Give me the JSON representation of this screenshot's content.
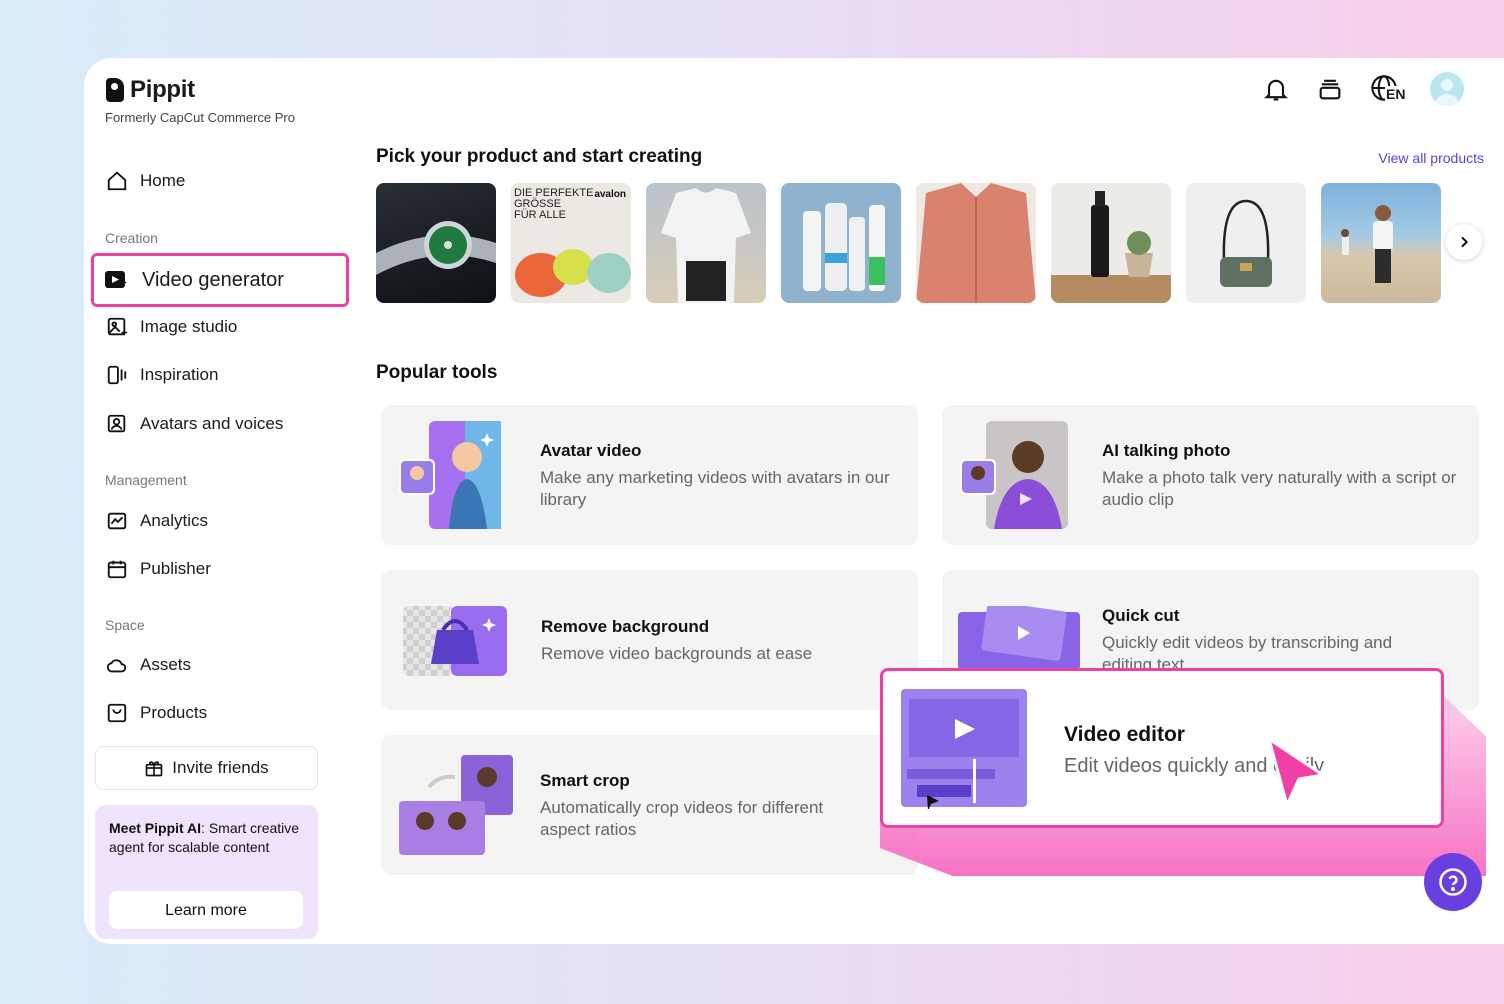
{
  "brand": {
    "name": "Pippit",
    "subtitle": "Formerly CapCut Commerce Pro"
  },
  "sidebar": {
    "home": "Home",
    "creation_label": "Creation",
    "video_generator": "Video generator",
    "image_studio": "Image studio",
    "inspiration": "Inspiration",
    "avatars_voices": "Avatars and voices",
    "management_label": "Management",
    "analytics": "Analytics",
    "publisher": "Publisher",
    "space_label": "Space",
    "assets": "Assets",
    "products": "Products",
    "invite": "Invite friends",
    "promo": {
      "bold": "Meet Pippit AI",
      "text": ": Smart creative agent for scalable content",
      "button": "Learn more"
    }
  },
  "header": {
    "lang": "EN"
  },
  "products": {
    "heading": "Pick your product and start creating",
    "view_all": "View all products",
    "thumb2": {
      "line1": "DIE PERFEKTE",
      "line2": "GRÖSSE",
      "line3": "FÜR ALLE",
      "brand": "avalon"
    }
  },
  "tools": {
    "heading": "Popular tools",
    "avatar_video": {
      "title": "Avatar video",
      "desc": "Make any marketing videos with avatars in our library"
    },
    "talking_photo": {
      "title": "AI talking photo",
      "desc": "Make a photo talk very naturally with a script or audio clip"
    },
    "remove_bg": {
      "title": "Remove background",
      "desc": "Remove video backgrounds at ease"
    },
    "quick_cut": {
      "title": "Quick cut",
      "desc": "Quickly edit videos by transcribing and editing text"
    },
    "smart_crop": {
      "title": "Smart crop",
      "desc": "Automatically crop videos for different aspect ratios"
    },
    "video_editor": {
      "title": "Video editor",
      "desc": "Edit videos quickly and easily"
    }
  },
  "colors": {
    "accent": "#6a3fe0",
    "highlight": "#ee3fa7",
    "card": "#f4f4f5"
  }
}
